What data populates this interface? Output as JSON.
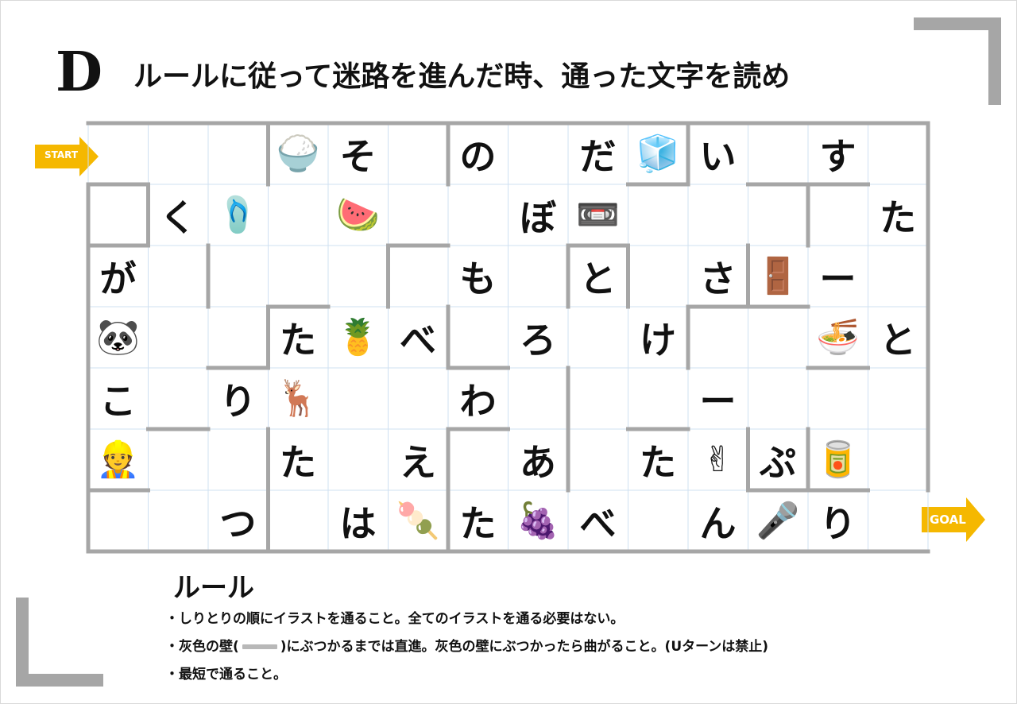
{
  "header": {
    "letter": "D",
    "title": "ルールに従って迷路を進んだ時、通った文字を読め"
  },
  "markers": {
    "start": "START",
    "goal": "GOAL",
    "arrow_color": "#f5b800"
  },
  "maze": {
    "cols": 14,
    "rows": 7,
    "wall_color": "#a6a6a6",
    "grid_color": "#cfe0f2",
    "cells": [
      [
        "",
        "",
        "",
        {
          "icon": "rice-bowl-icon",
          "glyph": "🍚"
        },
        "そ",
        "",
        "の",
        "",
        "だ",
        {
          "icon": "rubiks-cube-icon",
          "glyph": "🧊"
        },
        "い",
        "",
        "す",
        ""
      ],
      [
        "",
        "く",
        {
          "icon": "slippers-icon",
          "glyph": "🩴"
        },
        "",
        {
          "icon": "watermelon-icon",
          "glyph": "🍉"
        },
        "",
        "",
        "ぼ",
        {
          "icon": "cassette-tape-icon",
          "glyph": "📼"
        },
        "",
        "",
        "",
        "",
        "た"
      ],
      [
        "が",
        "",
        "",
        "",
        "",
        "",
        "も",
        "",
        "と",
        "",
        "さ",
        {
          "icon": "door-icon",
          "glyph": "🚪"
        },
        "ー",
        ""
      ],
      [
        {
          "icon": "panda-icon",
          "glyph": "🐼"
        },
        "",
        "",
        "た",
        {
          "icon": "pineapple-icon",
          "glyph": "🍍"
        },
        "べ",
        "",
        "ろ",
        "",
        "け",
        "",
        "",
        {
          "icon": "udon-bowl-icon",
          "glyph": "🍜"
        },
        "と"
      ],
      [
        "こ",
        "",
        "り",
        {
          "icon": "deer-icon",
          "glyph": "🦌"
        },
        "",
        "",
        "わ",
        "",
        "",
        "",
        "ー",
        "",
        "",
        ""
      ],
      [
        {
          "icon": "carpenter-icon",
          "glyph": "👷"
        },
        "",
        "",
        "た",
        "",
        "え",
        "",
        "あ",
        "",
        "た",
        {
          "icon": "peace-sign-icon",
          "glyph": "✌"
        },
        "ぷ",
        {
          "icon": "juice-can-icon",
          "glyph": "🥫"
        },
        ""
      ],
      [
        "",
        "",
        "つ",
        "",
        "は",
        {
          "icon": "dango-icon",
          "glyph": "🍡"
        },
        "た",
        {
          "icon": "grapes-icon",
          "glyph": "🍇"
        },
        "べ",
        "",
        "ん",
        {
          "icon": "microphone-icon",
          "glyph": "🎤"
        },
        "り",
        ""
      ]
    ]
  },
  "rules": {
    "title": "ルール",
    "rule1": "・しりとりの順にイラストを通ること。全てのイラストを通る必要はない。",
    "rule2_prefix": "・灰色の壁(",
    "rule2_suffix": ")にぶつかるまでは直進。灰色の壁にぶつかったら曲がること。(Uターンは禁止)",
    "rule3": "・最短で通ること。"
  }
}
